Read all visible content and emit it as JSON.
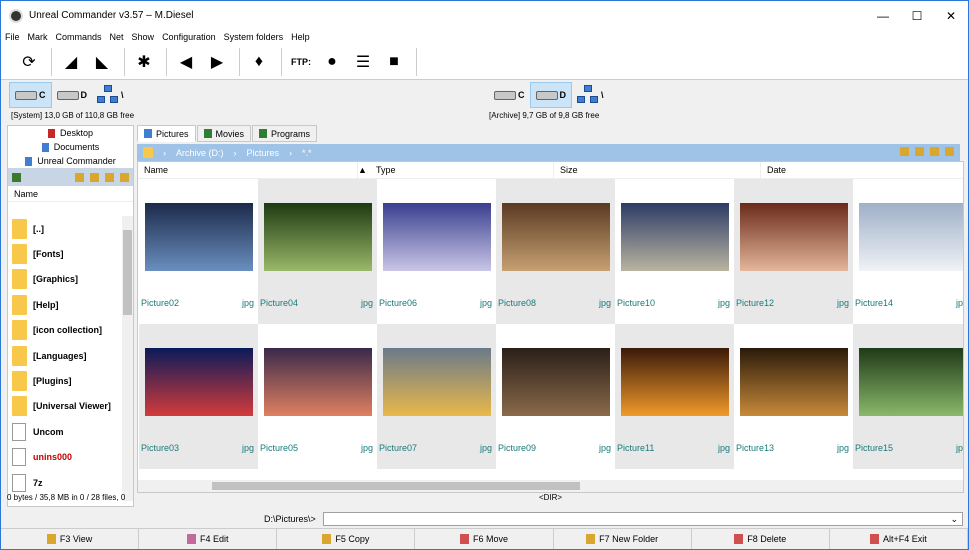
{
  "window": {
    "title": "Unreal Commander v3.57 – M.Diesel"
  },
  "menu": [
    "File",
    "Mark",
    "Commands",
    "Net",
    "Show",
    "Configuration",
    "System folders",
    "Help"
  ],
  "toolbar": {
    "ftp_label": "FTP:"
  },
  "left_drives": {
    "items": [
      {
        "letter": "C",
        "selected": true
      },
      {
        "letter": "D",
        "selected": false
      }
    ],
    "net": "\\",
    "info": "[System]  13,0 GB of  110,8 GB free"
  },
  "right_drives": {
    "items": [
      {
        "letter": "C",
        "selected": false
      },
      {
        "letter": "D",
        "selected": true
      }
    ],
    "net": "\\",
    "info": "[Archive]  9,7 GB of  9,8 GB free"
  },
  "left_panel": {
    "tree": [
      "Desktop",
      "Documents",
      "Unreal Commander"
    ],
    "column": "Name",
    "items": [
      {
        "name": "[..]",
        "type": "up"
      },
      {
        "name": "[Fonts]",
        "type": "folder"
      },
      {
        "name": "[Graphics]",
        "type": "folder"
      },
      {
        "name": "[Help]",
        "type": "folder"
      },
      {
        "name": "[icon collection]",
        "type": "folder"
      },
      {
        "name": "[Languages]",
        "type": "folder"
      },
      {
        "name": "[Plugins]",
        "type": "folder"
      },
      {
        "name": "[Universal Viewer]",
        "type": "folder"
      },
      {
        "name": "Uncom",
        "type": "file"
      },
      {
        "name": "unins000",
        "type": "file",
        "color": "#c00000"
      },
      {
        "name": "7z",
        "type": "file"
      }
    ],
    "status": "0 bytes / 35,8 MB in 0 / 28 files, 0"
  },
  "right_panel": {
    "tabs": [
      "Pictures",
      "Movies",
      "Programs"
    ],
    "path": [
      "Archive (D:)",
      "Pictures",
      "*.*"
    ],
    "columns": [
      "Name",
      "Type",
      "Size",
      "Date"
    ],
    "thumbnails": [
      {
        "name": "Picture02",
        "ext": "jpg",
        "colors": [
          "#1c2a4a",
          "#6a8fbf"
        ]
      },
      {
        "name": "Picture04",
        "ext": "jpg",
        "colors": [
          "#1e3a12",
          "#9bb86a"
        ]
      },
      {
        "name": "Picture06",
        "ext": "jpg",
        "colors": [
          "#3a3f8f",
          "#c9c6e6"
        ]
      },
      {
        "name": "Picture08",
        "ext": "jpg",
        "colors": [
          "#5a3a22",
          "#c7a073"
        ]
      },
      {
        "name": "Picture10",
        "ext": "jpg",
        "colors": [
          "#2d3c66",
          "#b9b4a0"
        ]
      },
      {
        "name": "Picture12",
        "ext": "jpg",
        "colors": [
          "#6a2a1a",
          "#e4b69a"
        ]
      },
      {
        "name": "Picture14",
        "ext": "jpg",
        "colors": [
          "#9fb0c8",
          "#f0f2f6"
        ]
      },
      {
        "name": "Picture03",
        "ext": "jpg",
        "colors": [
          "#0a1a5a",
          "#d43b3b"
        ]
      },
      {
        "name": "Picture05",
        "ext": "jpg",
        "colors": [
          "#3a2a4a",
          "#e08060"
        ]
      },
      {
        "name": "Picture07",
        "ext": "jpg",
        "colors": [
          "#6a7a8a",
          "#e9b84a"
        ]
      },
      {
        "name": "Picture09",
        "ext": "jpg",
        "colors": [
          "#2a1f18",
          "#8a6a4a"
        ]
      },
      {
        "name": "Picture11",
        "ext": "jpg",
        "colors": [
          "#3a1a0a",
          "#f29a2a"
        ]
      },
      {
        "name": "Picture13",
        "ext": "jpg",
        "colors": [
          "#2a1a0a",
          "#c88a3a"
        ]
      },
      {
        "name": "Picture15",
        "ext": "jpg",
        "colors": [
          "#1f3a18",
          "#8ab86a"
        ]
      }
    ],
    "dir_label": "<DIR>"
  },
  "command_line": {
    "path": "D:\\Pictures\\>",
    "value": ""
  },
  "fkeys": [
    {
      "label": "F3 View",
      "color": "#d9a62e"
    },
    {
      "label": "F4 Edit",
      "color": "#c06aa0"
    },
    {
      "label": "F5 Copy",
      "color": "#d9a62e"
    },
    {
      "label": "F6 Move",
      "color": "#d05050"
    },
    {
      "label": "F7 New Folder",
      "color": "#d9a62e"
    },
    {
      "label": "F8 Delete",
      "color": "#d05050"
    },
    {
      "label": "Alt+F4 Exit",
      "color": "#d05050"
    }
  ]
}
